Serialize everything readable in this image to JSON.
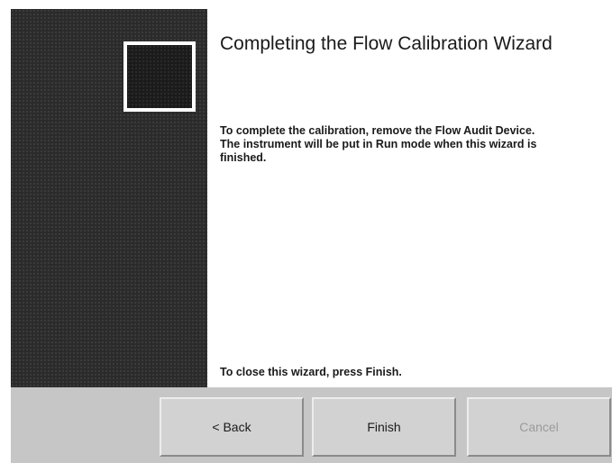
{
  "wizard": {
    "title": "Completing the Flow Calibration Wizard",
    "body": "To complete the calibration, remove the Flow Audit Device. The instrument will be put in Run mode when this wizard is finished.",
    "close_hint": "To close this wizard, press Finish."
  },
  "buttons": {
    "back_label": "< Back",
    "finish_label": "Finish",
    "cancel_label": "Cancel",
    "cancel_enabled": false
  },
  "colors": {
    "side_panel": "#2b2b2b",
    "button_bar": "#c6c6c6",
    "button_face": "#d2d2d2",
    "disabled_text": "#9b9b9b"
  },
  "icons": {
    "wizard_image": "wizard-graphic-icon"
  }
}
